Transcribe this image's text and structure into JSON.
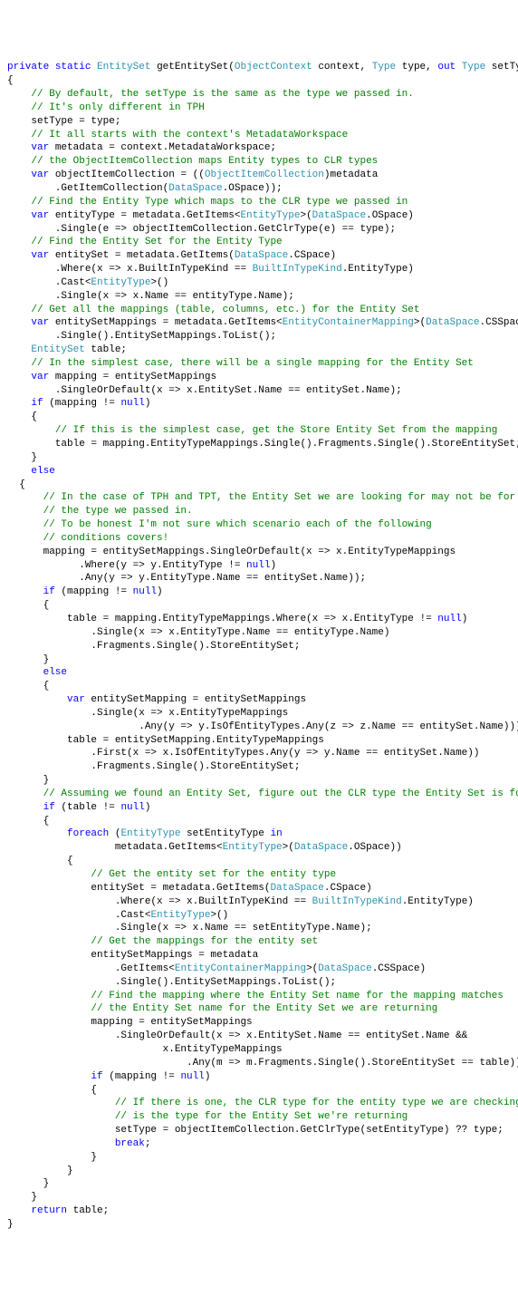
{
  "code": {
    "lines": [
      [
        [
          "kw",
          "private"
        ],
        [
          "",
          " "
        ],
        [
          "kw",
          "static"
        ],
        [
          "",
          " "
        ],
        [
          "type",
          "EntitySet"
        ],
        [
          "",
          " getEntitySet("
        ],
        [
          "type",
          "ObjectContext"
        ],
        [
          "",
          " context, "
        ],
        [
          "type",
          "Type"
        ],
        [
          "",
          " type, "
        ],
        [
          "kw",
          "out"
        ],
        [
          "",
          " "
        ],
        [
          "type",
          "Type"
        ],
        [
          "",
          " setType)"
        ]
      ],
      [
        [
          "",
          "{"
        ]
      ],
      [
        [
          "",
          "    "
        ],
        [
          "cm",
          "// By default, the setType is the same as the type we passed in."
        ]
      ],
      [
        [
          "",
          "    "
        ],
        [
          "cm",
          "// It's only different in TPH"
        ]
      ],
      [
        [
          "",
          "    setType = type;"
        ]
      ],
      [
        [
          "",
          "    "
        ],
        [
          "cm",
          "// It all starts with the context's MetadataWorkspace"
        ]
      ],
      [
        [
          "",
          "    "
        ],
        [
          "kw",
          "var"
        ],
        [
          "",
          " metadata = context.MetadataWorkspace;"
        ]
      ],
      [
        [
          "",
          "    "
        ],
        [
          "cm",
          "// the ObjectItemCollection maps Entity types to CLR types"
        ]
      ],
      [
        [
          "",
          "    "
        ],
        [
          "kw",
          "var"
        ],
        [
          "",
          " objectItemCollection = (("
        ],
        [
          "type",
          "ObjectItemCollection"
        ],
        [
          "",
          ")metadata"
        ]
      ],
      [
        [
          "",
          "        .GetItemCollection("
        ],
        [
          "type",
          "DataSpace"
        ],
        [
          "",
          ".OSpace));"
        ]
      ],
      [
        [
          "",
          "    "
        ],
        [
          "cm",
          "// Find the Entity Type which maps to the CLR type we passed in"
        ]
      ],
      [
        [
          "",
          "    "
        ],
        [
          "kw",
          "var"
        ],
        [
          "",
          " entityType = metadata.GetItems<"
        ],
        [
          "type",
          "EntityType"
        ],
        [
          "",
          ">("
        ],
        [
          "type",
          "DataSpace"
        ],
        [
          "",
          ".OSpace)"
        ]
      ],
      [
        [
          "",
          "        .Single(e => objectItemCollection.GetClrType(e) == type);"
        ]
      ],
      [
        [
          "",
          "    "
        ],
        [
          "cm",
          "// Find the Entity Set for the Entity Type"
        ]
      ],
      [
        [
          "",
          "    "
        ],
        [
          "kw",
          "var"
        ],
        [
          "",
          " entitySet = metadata.GetItems("
        ],
        [
          "type",
          "DataSpace"
        ],
        [
          "",
          ".CSpace)"
        ]
      ],
      [
        [
          "",
          "        .Where(x => x.BuiltInTypeKind == "
        ],
        [
          "type",
          "BuiltInTypeKind"
        ],
        [
          "",
          ".EntityType)"
        ]
      ],
      [
        [
          "",
          "        .Cast<"
        ],
        [
          "type",
          "EntityType"
        ],
        [
          "",
          ">()"
        ]
      ],
      [
        [
          "",
          "        .Single(x => x.Name == entityType.Name);"
        ]
      ],
      [
        [
          "",
          "    "
        ],
        [
          "cm",
          "// Get all the mappings (table, columns, etc.) for the Entity Set"
        ]
      ],
      [
        [
          "",
          "    "
        ],
        [
          "kw",
          "var"
        ],
        [
          "",
          " entitySetMappings = metadata.GetItems<"
        ],
        [
          "type",
          "EntityContainerMapping"
        ],
        [
          "",
          ">("
        ],
        [
          "type",
          "DataSpace"
        ],
        [
          "",
          ".CSSpace)"
        ]
      ],
      [
        [
          "",
          "        .Single().EntitySetMappings.ToList();"
        ]
      ],
      [
        [
          "",
          "    "
        ],
        [
          "type",
          "EntitySet"
        ],
        [
          "",
          " table;"
        ]
      ],
      [
        [
          "",
          "    "
        ],
        [
          "cm",
          "// In the simplest case, there will be a single mapping for the Entity Set"
        ]
      ],
      [
        [
          "",
          "    "
        ],
        [
          "kw",
          "var"
        ],
        [
          "",
          " mapping = entitySetMappings"
        ]
      ],
      [
        [
          "",
          "        .SingleOrDefault(x => x.EntitySet.Name == entitySet.Name);"
        ]
      ],
      [
        [
          "",
          "    "
        ],
        [
          "kw",
          "if"
        ],
        [
          "",
          " (mapping != "
        ],
        [
          "kw",
          "null"
        ],
        [
          "",
          ")"
        ]
      ],
      [
        [
          "",
          "    {"
        ]
      ],
      [
        [
          "",
          "        "
        ],
        [
          "cm",
          "// If this is the simplest case, get the Store Entity Set from the mapping"
        ]
      ],
      [
        [
          "",
          "        table = mapping.EntityTypeMappings.Single().Fragments.Single().StoreEntitySet;"
        ]
      ],
      [
        [
          "",
          "    }"
        ]
      ],
      [
        [
          "",
          "    "
        ],
        [
          "kw",
          "else"
        ]
      ],
      [
        [
          "",
          "  {"
        ]
      ],
      [
        [
          "",
          "      "
        ],
        [
          "cm",
          "// In the case of TPH and TPT, the Entity Set we are looking for may not be for"
        ]
      ],
      [
        [
          "",
          "      "
        ],
        [
          "cm",
          "// the type we passed in."
        ]
      ],
      [
        [
          "",
          "      "
        ],
        [
          "cm",
          "// To be honest I'm not sure which scenario each of the following"
        ]
      ],
      [
        [
          "",
          "      "
        ],
        [
          "cm",
          "// conditions covers!"
        ]
      ],
      [
        [
          "",
          "      mapping = entitySetMappings.SingleOrDefault(x => x.EntityTypeMappings"
        ]
      ],
      [
        [
          "",
          "            .Where(y => y.EntityType != "
        ],
        [
          "kw",
          "null"
        ],
        [
          "",
          ")"
        ]
      ],
      [
        [
          "",
          "            .Any(y => y.EntityType.Name == entitySet.Name));"
        ]
      ],
      [
        [
          "",
          "      "
        ],
        [
          "kw",
          "if"
        ],
        [
          "",
          " (mapping != "
        ],
        [
          "kw",
          "null"
        ],
        [
          "",
          ")"
        ]
      ],
      [
        [
          "",
          "      {"
        ]
      ],
      [
        [
          "",
          "          table = mapping.EntityTypeMappings.Where(x => x.EntityType != "
        ],
        [
          "kw",
          "null"
        ],
        [
          "",
          ")"
        ]
      ],
      [
        [
          "",
          "              .Single(x => x.EntityType.Name == entityType.Name)"
        ]
      ],
      [
        [
          "",
          "              .Fragments.Single().StoreEntitySet;"
        ]
      ],
      [
        [
          "",
          "      }"
        ]
      ],
      [
        [
          "",
          "      "
        ],
        [
          "kw",
          "else"
        ]
      ],
      [
        [
          "",
          "      {"
        ]
      ],
      [
        [
          "",
          "          "
        ],
        [
          "kw",
          "var"
        ],
        [
          "",
          " entitySetMapping = entitySetMappings"
        ]
      ],
      [
        [
          "",
          "              .Single(x => x.EntityTypeMappings"
        ]
      ],
      [
        [
          "",
          "                      .Any(y => y.IsOfEntityTypes.Any(z => z.Name == entitySet.Name)));"
        ]
      ],
      [
        [
          "",
          "          table = entitySetMapping.EntityTypeMappings"
        ]
      ],
      [
        [
          "",
          "              .First(x => x.IsOfEntityTypes.Any(y => y.Name == entitySet.Name))"
        ]
      ],
      [
        [
          "",
          "              .Fragments.Single().StoreEntitySet;"
        ]
      ],
      [
        [
          "",
          "      }"
        ]
      ],
      [
        [
          "",
          "      "
        ],
        [
          "cm",
          "// Assuming we found an Entity Set, figure out the CLR type the Entity Set is for"
        ]
      ],
      [
        [
          "",
          "      "
        ],
        [
          "kw",
          "if"
        ],
        [
          "",
          " (table != "
        ],
        [
          "kw",
          "null"
        ],
        [
          "",
          ")"
        ]
      ],
      [
        [
          "",
          "      {"
        ]
      ],
      [
        [
          "",
          "          "
        ],
        [
          "kw",
          "foreach"
        ],
        [
          "",
          " ("
        ],
        [
          "type",
          "EntityType"
        ],
        [
          "",
          " setEntityType "
        ],
        [
          "kw",
          "in"
        ]
      ],
      [
        [
          "",
          "                  metadata.GetItems<"
        ],
        [
          "type",
          "EntityType"
        ],
        [
          "",
          ">("
        ],
        [
          "type",
          "DataSpace"
        ],
        [
          "",
          ".OSpace))"
        ]
      ],
      [
        [
          "",
          "          {"
        ]
      ],
      [
        [
          "",
          "              "
        ],
        [
          "cm",
          "// Get the entity set for the entity type"
        ]
      ],
      [
        [
          "",
          "              entitySet = metadata.GetItems("
        ],
        [
          "type",
          "DataSpace"
        ],
        [
          "",
          ".CSpace)"
        ]
      ],
      [
        [
          "",
          "                  .Where(x => x.BuiltInTypeKind == "
        ],
        [
          "type",
          "BuiltInTypeKind"
        ],
        [
          "",
          ".EntityType)"
        ]
      ],
      [
        [
          "",
          "                  .Cast<"
        ],
        [
          "type",
          "EntityType"
        ],
        [
          "",
          ">()"
        ]
      ],
      [
        [
          "",
          "                  .Single(x => x.Name == setEntityType.Name);"
        ]
      ],
      [
        [
          "",
          "              "
        ],
        [
          "cm",
          "// Get the mappings for the entity set"
        ]
      ],
      [
        [
          "",
          "              entitySetMappings = metadata"
        ]
      ],
      [
        [
          "",
          "                  .GetItems<"
        ],
        [
          "type",
          "EntityContainerMapping"
        ],
        [
          "",
          ">("
        ],
        [
          "type",
          "DataSpace"
        ],
        [
          "",
          ".CSSpace)"
        ]
      ],
      [
        [
          "",
          "                  .Single().EntitySetMappings.ToList();"
        ]
      ],
      [
        [
          "",
          "              "
        ],
        [
          "cm",
          "// Find the mapping where the Entity Set name for the mapping matches"
        ]
      ],
      [
        [
          "",
          "              "
        ],
        [
          "cm",
          "// the Entity Set name for the Entity Set we are returning"
        ]
      ],
      [
        [
          "",
          "              mapping = entitySetMappings"
        ]
      ],
      [
        [
          "",
          "                  .SingleOrDefault(x => x.EntitySet.Name == entitySet.Name &&"
        ]
      ],
      [
        [
          "",
          "                          x.EntityTypeMappings"
        ]
      ],
      [
        [
          "",
          "                              .Any(m => m.Fragments.Single().StoreEntitySet == table));"
        ]
      ],
      [
        [
          "",
          "              "
        ],
        [
          "kw",
          "if"
        ],
        [
          "",
          " (mapping != "
        ],
        [
          "kw",
          "null"
        ],
        [
          "",
          ")"
        ]
      ],
      [
        [
          "",
          "              {"
        ]
      ],
      [
        [
          "",
          "                  "
        ],
        [
          "cm",
          "// If there is one, the CLR type for the entity type we are checking"
        ]
      ],
      [
        [
          "",
          "                  "
        ],
        [
          "cm",
          "// is the type for the Entity Set we're returning"
        ]
      ],
      [
        [
          "",
          "                  setType = objectItemCollection.GetClrType(setEntityType) ?? type;"
        ]
      ],
      [
        [
          "",
          "                  "
        ],
        [
          "kw",
          "break"
        ],
        [
          "",
          ";"
        ]
      ],
      [
        [
          "",
          "              }"
        ]
      ],
      [
        [
          "",
          "          }"
        ]
      ],
      [
        [
          "",
          "      }"
        ]
      ],
      [
        [
          "",
          "    }"
        ]
      ],
      [
        [
          "",
          "    "
        ],
        [
          "kw",
          "return"
        ],
        [
          "",
          " table;"
        ]
      ],
      [
        [
          "",
          "}"
        ]
      ]
    ]
  }
}
